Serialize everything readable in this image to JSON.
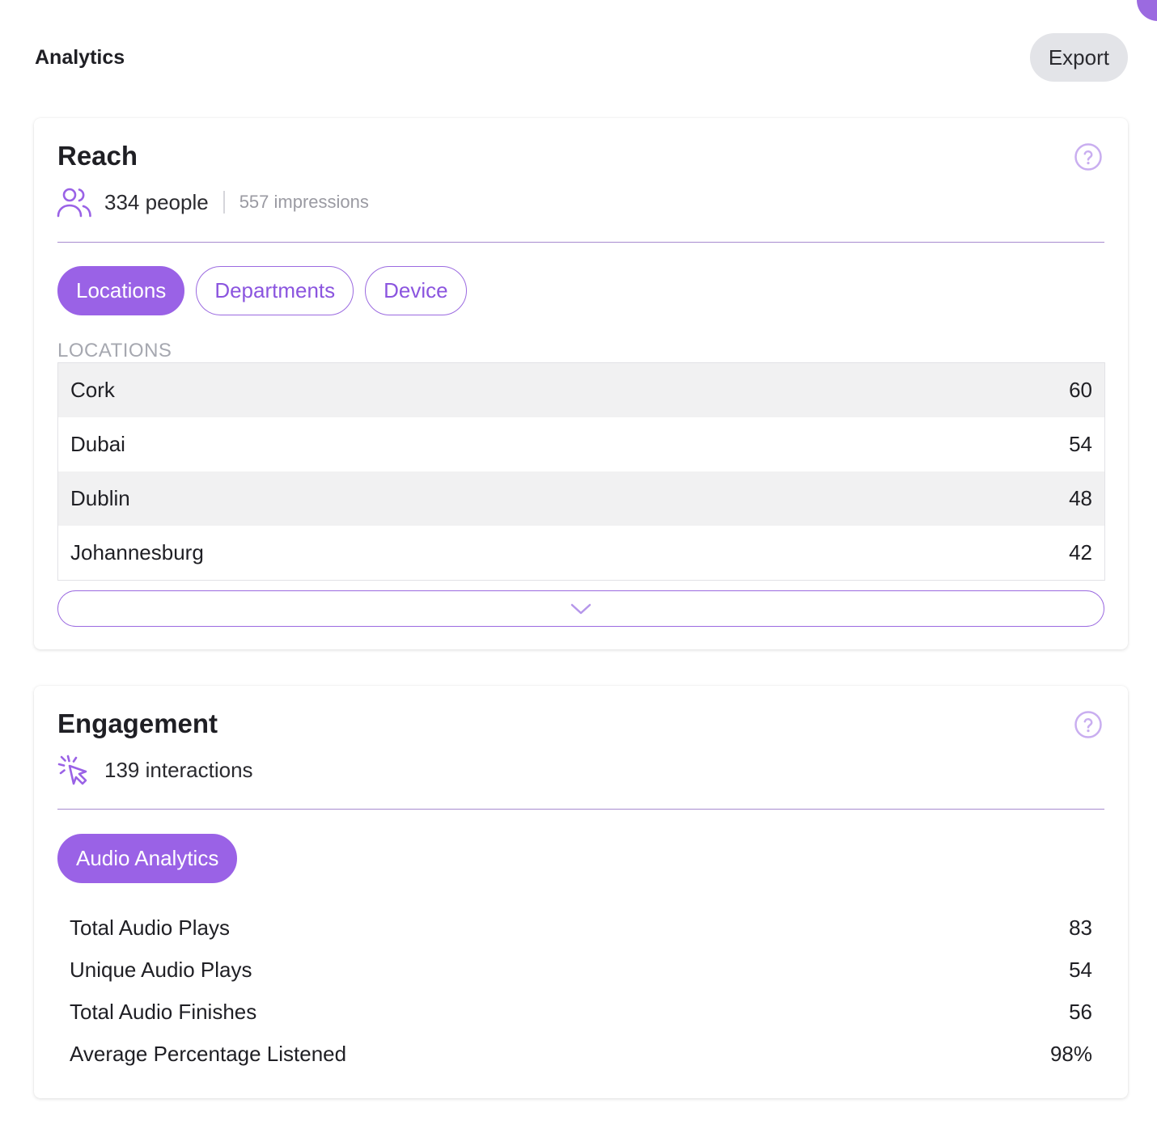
{
  "header": {
    "title": "Analytics",
    "export_label": "Export"
  },
  "reach": {
    "title": "Reach",
    "people": "334 people",
    "impressions": "557 impressions",
    "tabs": [
      {
        "label": "Locations",
        "active": true
      },
      {
        "label": "Departments",
        "active": false
      },
      {
        "label": "Device",
        "active": false
      }
    ],
    "section_label": "LOCATIONS",
    "locations": [
      {
        "name": "Cork",
        "value": "60"
      },
      {
        "name": "Dubai",
        "value": "54"
      },
      {
        "name": "Dublin",
        "value": "48"
      },
      {
        "name": "Johannesburg",
        "value": "42"
      }
    ],
    "icons": {
      "summary": "users-icon",
      "help": "help-circle-icon",
      "expand": "chevron-down-icon"
    }
  },
  "engagement": {
    "title": "Engagement",
    "interactions": "139 interactions",
    "tabs": [
      {
        "label": "Audio Analytics",
        "active": true
      }
    ],
    "stats": [
      {
        "label": "Total Audio Plays",
        "value": "83"
      },
      {
        "label": "Unique Audio Plays",
        "value": "54"
      },
      {
        "label": "Total Audio Finishes",
        "value": "56"
      },
      {
        "label": "Average Percentage Listened",
        "value": "98%"
      }
    ],
    "icons": {
      "summary": "cursor-click-icon",
      "help": "help-circle-icon"
    }
  },
  "colors": {
    "accent": "#9a62e6",
    "accent_light": "#c9aef0",
    "divider": "#a78bcf",
    "row_shade": "#f1f1f2"
  }
}
